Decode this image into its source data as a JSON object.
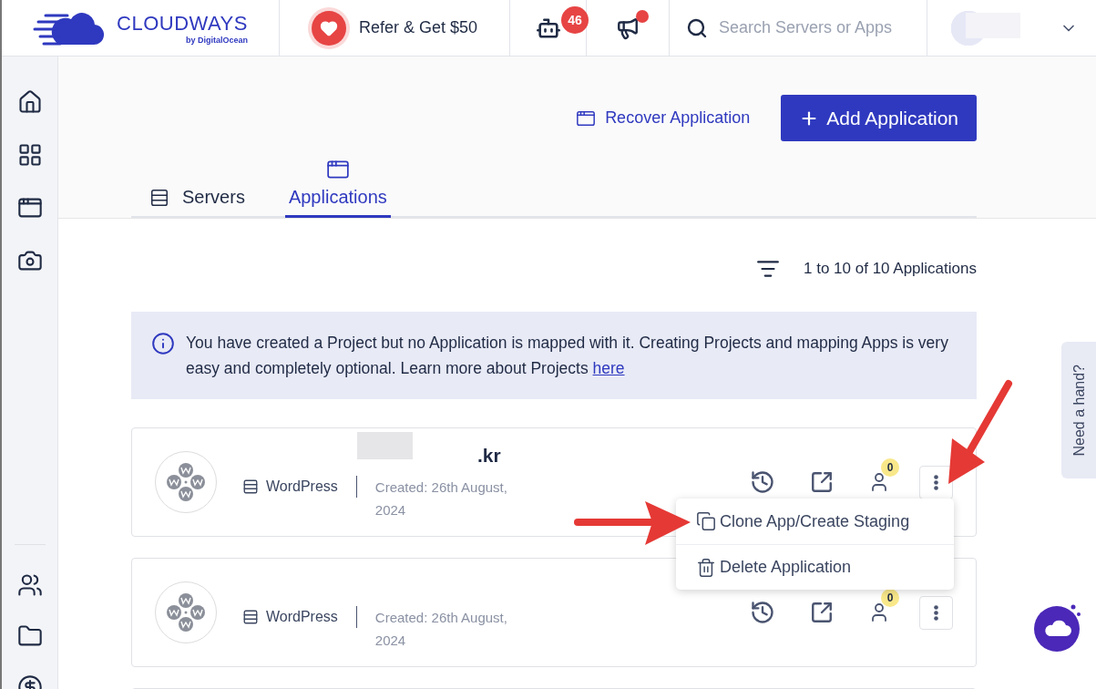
{
  "topbar": {
    "logo": {
      "name": "CLOUDWAYS",
      "byline": "by DigitalOcean"
    },
    "referral": "Refer & Get $50",
    "bot_badge": "46",
    "announcements_unread": true,
    "search": {
      "placeholder": "Search Servers or Apps"
    }
  },
  "actions": {
    "recover": "Recover Application",
    "add": "Add Application"
  },
  "tabs": [
    {
      "label": "Servers",
      "selected": false
    },
    {
      "label": "Applications",
      "selected": true
    }
  ],
  "count": "1 to 10 of 10 Applications",
  "notice": {
    "text": "You have created a Project but no Application is mapped with it. Creating Projects and mapping Apps is very easy and completely optional. Learn more about Projects",
    "link": "here"
  },
  "apps": [
    {
      "name": ".kr",
      "type": "WordPress",
      "created": "Created: 26th August, 2024",
      "collaborators": "0"
    },
    {
      "type": "WordPress",
      "created": "Created: 26th August, 2024",
      "collaborators": "0"
    }
  ],
  "menu": [
    {
      "label": "Clone App/Create Staging",
      "kind": "clone"
    },
    {
      "label": "Delete Application",
      "kind": "delete"
    }
  ],
  "help_tab": "Need a hand?"
}
